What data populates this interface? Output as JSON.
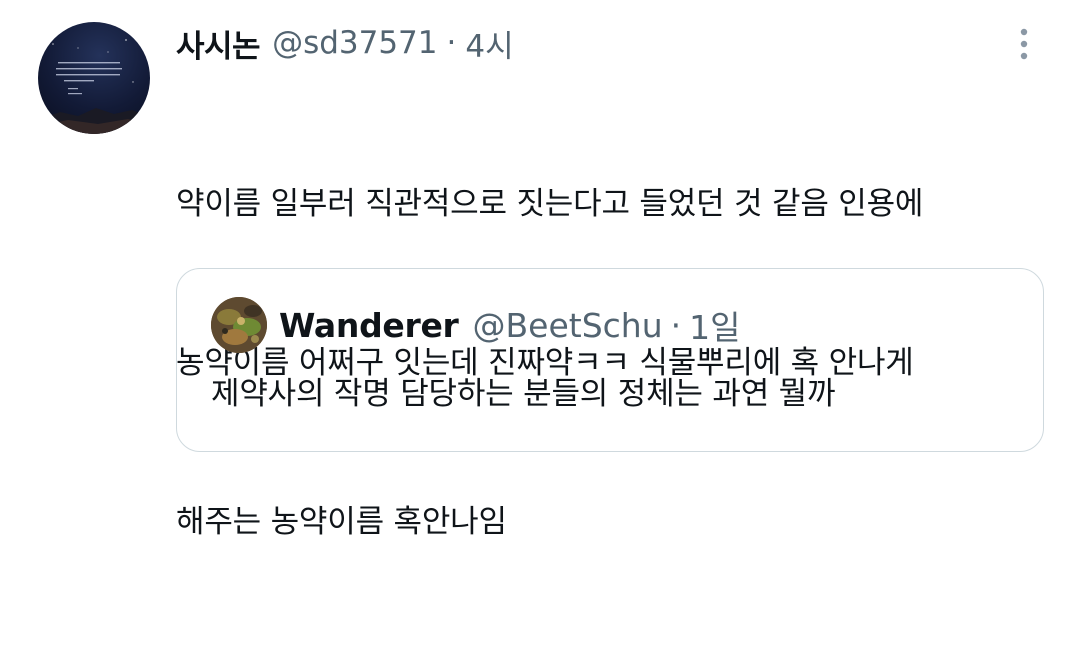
{
  "tweet": {
    "display_name": "사시논",
    "handle": "@sd37571",
    "separator": "·",
    "time": "4시",
    "lines": [
      "약이름 일부러 직관적으로 짓는다고 들었던 것 같음 인용에",
      "농약이름 어쩌구 잇는데 진짜약ㅋㅋ 식물뿌리에 혹 안나게",
      "해주는 농약이름 혹안나임"
    ],
    "more_icon": "more-vertical-icon"
  },
  "quote": {
    "display_name": "Wanderer",
    "handle": "@BeetSchu",
    "separator": "·",
    "time": "1일",
    "text": "제약사의 작명 담당하는 분들의 정체는 과연 뭘까"
  },
  "colors": {
    "text_primary": "#0f1419",
    "text_secondary": "#536471",
    "border": "#cfd9de"
  }
}
